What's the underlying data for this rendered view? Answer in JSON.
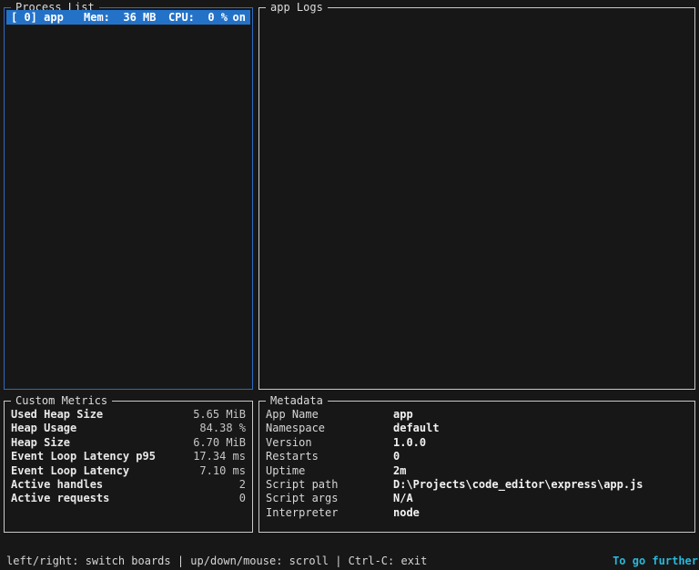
{
  "colors": {
    "background": "#171717",
    "panel_border": "#c9c9c9",
    "selected_border": "#2e6ac0",
    "highlight_row": "#2472c8",
    "accent_cyan": "#29b8db"
  },
  "process_list": {
    "title": "Process List",
    "row": {
      "name": "[ 0] app",
      "mem": "Mem:  36 MB",
      "cpu": "CPU:  0 %",
      "status": "on"
    }
  },
  "logs": {
    "title": "app Logs"
  },
  "custom_metrics": {
    "title": "Custom Metrics",
    "rows": [
      {
        "label": "Used Heap Size",
        "value": "5.65 MiB"
      },
      {
        "label": "Heap Usage",
        "value": "84.38 %"
      },
      {
        "label": "Heap Size",
        "value": "6.70 MiB"
      },
      {
        "label": "Event Loop Latency p95",
        "value": "17.34 ms"
      },
      {
        "label": "Event Loop Latency",
        "value": "7.10 ms"
      },
      {
        "label": "Active handles",
        "value": "2"
      },
      {
        "label": "Active requests",
        "value": "0"
      }
    ]
  },
  "metadata": {
    "title": "Metadata",
    "rows": [
      {
        "label": "App Name",
        "value": "app"
      },
      {
        "label": "Namespace",
        "value": "default"
      },
      {
        "label": "Version",
        "value": "1.0.0"
      },
      {
        "label": "Restarts",
        "value": "0"
      },
      {
        "label": "Uptime",
        "value": "2m"
      },
      {
        "label": "Script path",
        "value": "D:\\Projects\\code_editor\\express\\app.js"
      },
      {
        "label": "Script args",
        "value": "N/A"
      },
      {
        "label": "Interpreter",
        "value": "node"
      }
    ]
  },
  "status_bar": {
    "left": "left/right: switch boards | up/down/mouse: scroll | Ctrl-C: exit",
    "right": "To go further"
  }
}
